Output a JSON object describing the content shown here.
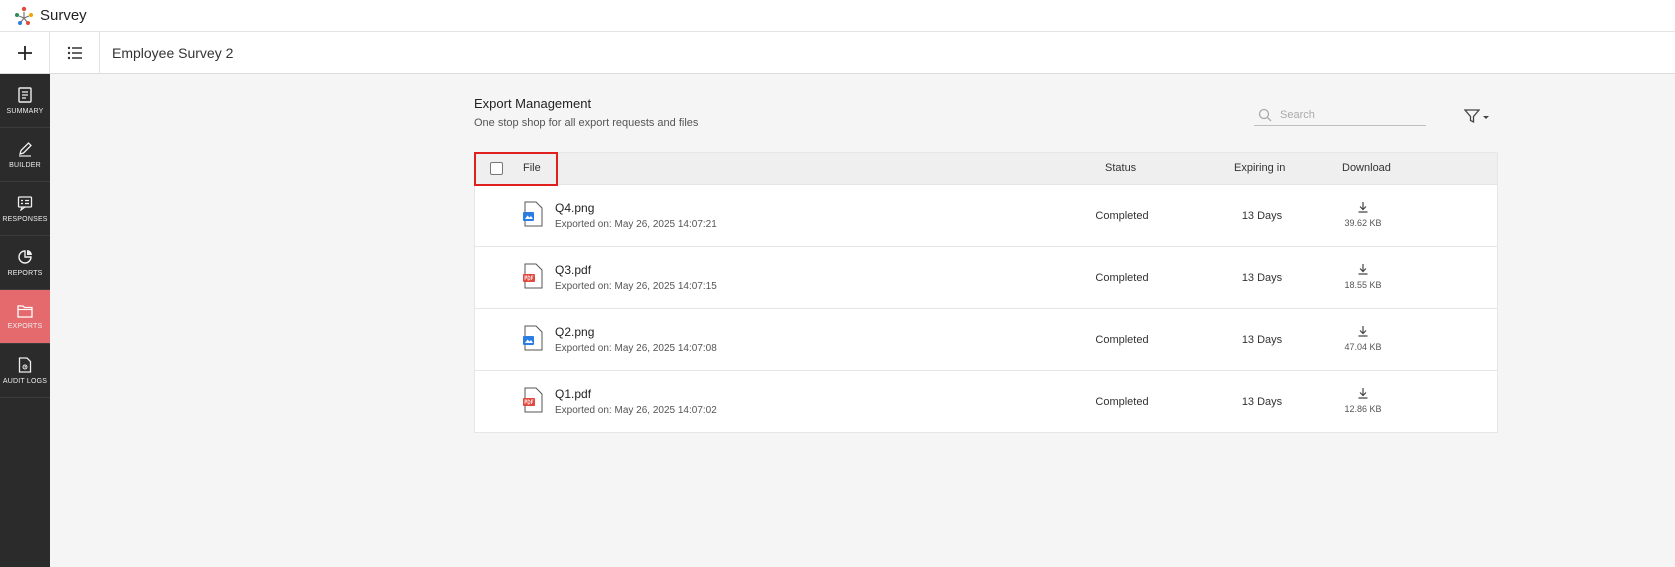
{
  "app": {
    "name": "Survey"
  },
  "subbar": {
    "title": "Employee Survey 2"
  },
  "sidebar": {
    "items": [
      {
        "label": "SUMMARY"
      },
      {
        "label": "BUILDER"
      },
      {
        "label": "RESPONSES"
      },
      {
        "label": "REPORTS"
      },
      {
        "label": "EXPORTS"
      },
      {
        "label": "AUDIT LOGS"
      }
    ],
    "active": "EXPORTS"
  },
  "page": {
    "title": "Export Management",
    "subtitle": "One stop shop for all export requests and files",
    "search_placeholder": "Search"
  },
  "table": {
    "headers": {
      "file": "File",
      "status": "Status",
      "expiry": "Expiring in",
      "download": "Download"
    },
    "rows": [
      {
        "name": "Q4.png",
        "type": "png",
        "exported": "Exported on: May 26, 2025 14:07:21",
        "status": "Completed",
        "expiry": "13 Days",
        "size": "39.62 KB"
      },
      {
        "name": "Q3.pdf",
        "type": "pdf",
        "exported": "Exported on: May 26, 2025 14:07:15",
        "status": "Completed",
        "expiry": "13 Days",
        "size": "18.55 KB"
      },
      {
        "name": "Q2.png",
        "type": "png",
        "exported": "Exported on: May 26, 2025 14:07:08",
        "status": "Completed",
        "expiry": "13 Days",
        "size": "47.04 KB"
      },
      {
        "name": "Q1.pdf",
        "type": "pdf",
        "exported": "Exported on: May 26, 2025 14:07:02",
        "status": "Completed",
        "expiry": "13 Days",
        "size": "12.86 KB"
      }
    ]
  },
  "colors": {
    "sidebar_bg": "#2b2b2b",
    "active_nav": "#e46a6e",
    "highlight_border": "#e0201e",
    "png_icon": "#2a7de1",
    "pdf_icon": "#e0483e"
  }
}
